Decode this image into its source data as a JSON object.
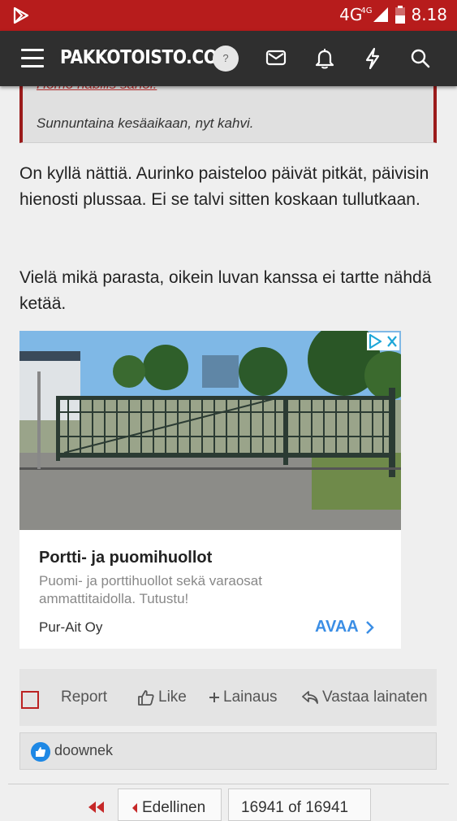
{
  "status_bar": {
    "network": "4G",
    "network_small": "4G",
    "time": "8.18",
    "icons": [
      "play-store-icon",
      "signal-icon",
      "battery-icon"
    ]
  },
  "header": {
    "logo": "PAKKOTOISTO.COM",
    "help": "?",
    "icons": [
      "menu-icon",
      "mail-icon",
      "bell-icon",
      "lightning-icon",
      "search-icon"
    ]
  },
  "quote": {
    "cut_line": "Homo habilis sanoi:",
    "signature": "Sunnuntaina kesäaikaan, nyt kahvi."
  },
  "post": {
    "paragraph1": "On kyllä nättiä. Aurinko paisteloo päivät pitkät, päivisin hienosti plussaa. Ei se talvi sitten koskaan tullutkaan.",
    "paragraph2": "Vielä mikä parasta, oikein luvan kanssa ei tartte nähdä ketää."
  },
  "ad": {
    "title": "Portti- ja puomihuollot",
    "description": "Puomi- ja porttihuollot sekä varaosat ammattitaidolla. Tutustu!",
    "advertiser": "Pur-Ait Oy",
    "cta": "AVAA",
    "accent_color": "#3b8ee5"
  },
  "actions": {
    "report": "Report",
    "like": "Like",
    "quote": "Lainaus",
    "reply": "Vastaa lainaten"
  },
  "reactions": {
    "user": "doownek"
  },
  "pagination": {
    "prev": "Edellinen",
    "page_info": "16941 of 16941"
  },
  "colors": {
    "brand_red": "#b71c1c",
    "topbar": "#2f2f2f",
    "quote_border": "#9b1b1b"
  }
}
